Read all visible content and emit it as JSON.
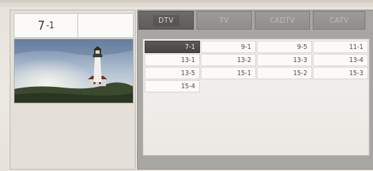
{
  "current_channel": {
    "major": "7",
    "minor": "-1"
  },
  "tabs": [
    {
      "label": "DTV",
      "active": true
    },
    {
      "label": "TV",
      "active": false
    },
    {
      "label": "CADTV",
      "active": false
    },
    {
      "label": "CATV",
      "active": false
    }
  ],
  "channels": [
    "7-1",
    "9-1",
    "9-5",
    "11-1",
    "13-1",
    "13-2",
    "13-3",
    "13-4",
    "13-5",
    "15-1",
    "15-2",
    "15-3",
    "15-4"
  ],
  "selected_channel": "7-1",
  "preview_image": "lighthouse-scene",
  "colors": {
    "selected_bg": "#4f4e4c",
    "tab_active": "#666563",
    "tab_inactive": "#959491"
  }
}
